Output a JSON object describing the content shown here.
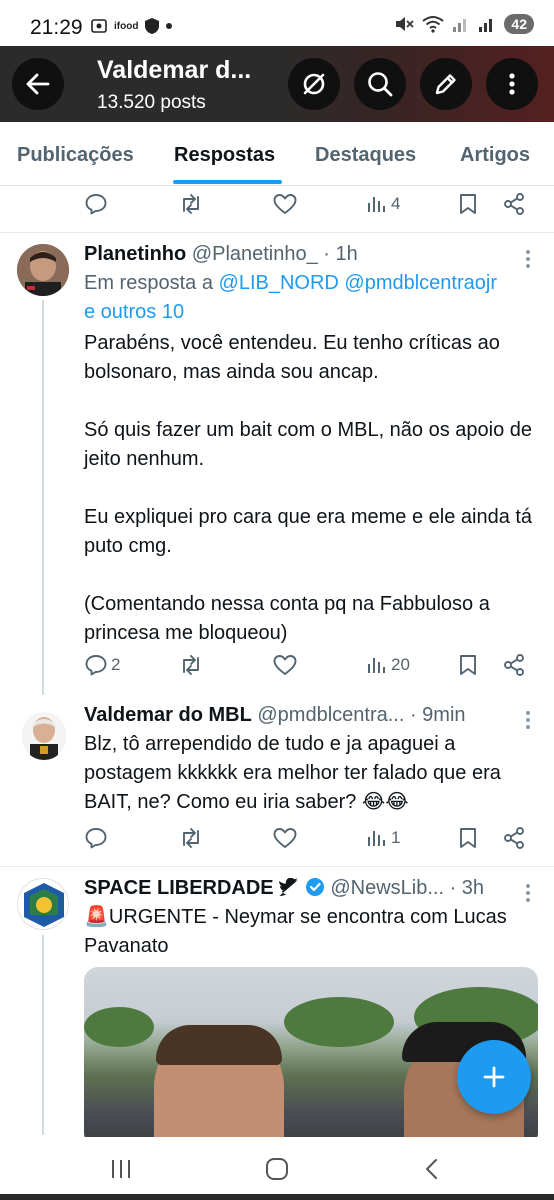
{
  "status_bar": {
    "time": "21:29",
    "carrier_icon_text": "ifood",
    "battery": "42"
  },
  "header": {
    "title": "Valdemar d...",
    "subtitle": "13.520 posts",
    "buttons": [
      "back-arrow-icon",
      "hide-icon",
      "search-icon",
      "edit-icon",
      "more-vertical-icon"
    ]
  },
  "tabs": [
    {
      "label": "Publicações",
      "active": false
    },
    {
      "label": "Respostas",
      "active": true
    },
    {
      "label": "Destaques",
      "active": false
    },
    {
      "label": "Artigos",
      "active": false
    }
  ],
  "top_actions": {
    "views": "4"
  },
  "tweets": [
    {
      "name": "Planetinho",
      "handle": "@Planetinho_ · 1h",
      "reply_prefix": "Em resposta a ",
      "reply_users": "@LIB_NORD @pmdblcentraojr",
      "reply_more": "e outros 10",
      "paragraphs": [
        "Parabéns, você entendeu. Eu tenho críticas ao bolsonaro, mas ainda sou ancap.",
        "Só quis fazer um bait com o MBL, não os apoio de jeito nenhum.",
        "Eu expliquei pro cara que era meme e ele ainda tá puto cmg.",
        "(Comentando nessa conta pq na Fabbuloso a princesa me bloqueou)"
      ],
      "replies": "2",
      "views": "20"
    },
    {
      "name": "Valdemar do MBL",
      "handle": "@pmdblcentra... · 9min",
      "text": "Blz, tô arrependido de tudo e ja apaguei a postagem kkkkkk era melhor ter falado que era BAIT, ne? Como eu iria saber? 😂😂",
      "replies": "",
      "views": "1"
    },
    {
      "name": "SPACE LIBERDADE",
      "handle": "@NewsLib... · 3h",
      "text": "🚨URGENTE - Neymar se encontra com Lucas Pavanato"
    }
  ],
  "colors": {
    "accent": "#1d9bf0",
    "text_primary": "#0f1419",
    "text_secondary": "#536471",
    "header_bg": "#2b2b2b"
  }
}
